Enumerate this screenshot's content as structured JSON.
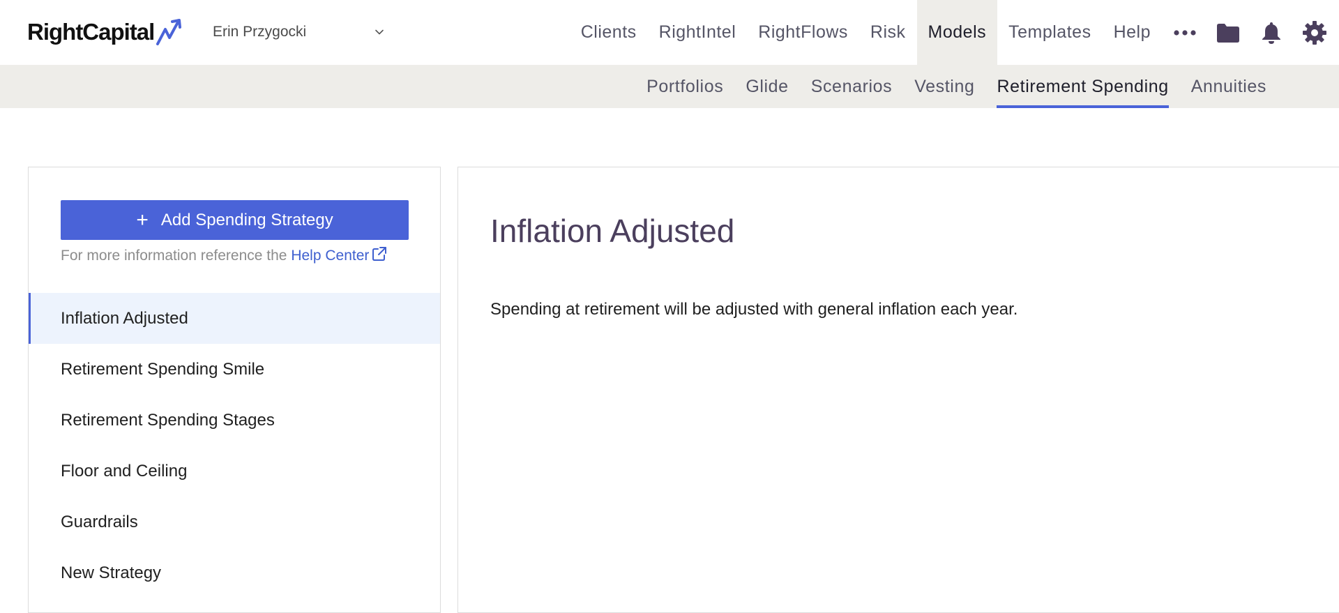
{
  "brand": {
    "logo_text": "RightCapital",
    "accent": "#4a63d8",
    "title_color": "#4b3f5d",
    "subnav_bg": "#eeede9"
  },
  "header": {
    "client_name": "Erin Przygocki",
    "nav": [
      {
        "label": "Clients"
      },
      {
        "label": "RightIntel"
      },
      {
        "label": "RightFlows"
      },
      {
        "label": "Risk"
      },
      {
        "label": "Models",
        "active": true
      },
      {
        "label": "Templates"
      },
      {
        "label": "Help"
      }
    ],
    "icons": [
      "more-icon",
      "folder-icon",
      "bell-icon",
      "gear-icon"
    ]
  },
  "subnav": {
    "items": [
      {
        "label": "Portfolios"
      },
      {
        "label": "Glide"
      },
      {
        "label": "Scenarios"
      },
      {
        "label": "Vesting"
      },
      {
        "label": "Retirement Spending",
        "active": true
      },
      {
        "label": "Annuities"
      }
    ]
  },
  "sidebar": {
    "add_button_label": "Add Spending Strategy",
    "help_prefix": "For more information reference the",
    "help_link": "Help Center",
    "strategies": [
      {
        "label": "Inflation Adjusted",
        "selected": true
      },
      {
        "label": "Retirement Spending Smile"
      },
      {
        "label": "Retirement Spending Stages"
      },
      {
        "label": "Floor and Ceiling"
      },
      {
        "label": "Guardrails"
      },
      {
        "label": "New Strategy"
      }
    ]
  },
  "detail": {
    "title": "Inflation Adjusted",
    "description": "Spending at retirement will be adjusted with general inflation each year."
  }
}
